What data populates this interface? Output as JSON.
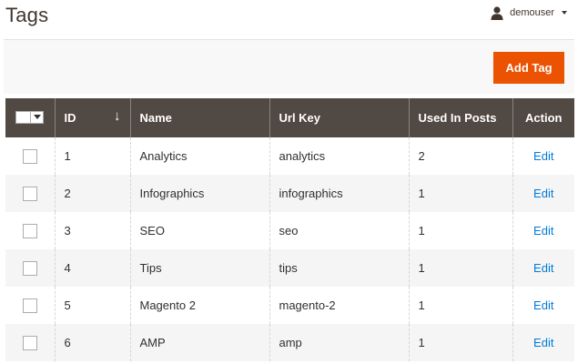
{
  "header": {
    "title": "Tags",
    "user": {
      "name": "demouser",
      "icon": "user-icon",
      "menu_icon": "chevron-down-icon"
    }
  },
  "actions": {
    "add_label": "Add Tag",
    "accent": "#eb5202"
  },
  "grid": {
    "header_bg": "#514943",
    "columns": {
      "id": "ID",
      "name": "Name",
      "url_key": "Url Key",
      "used_in_posts": "Used In Posts",
      "action": "Action"
    },
    "sort": {
      "column": "ID",
      "direction": "desc",
      "icon": "↓"
    },
    "rows": [
      {
        "id": "1",
        "name": "Analytics",
        "url_key": "analytics",
        "used": "2",
        "action": "Edit"
      },
      {
        "id": "2",
        "name": "Infographics",
        "url_key": "infographics",
        "used": "1",
        "action": "Edit"
      },
      {
        "id": "3",
        "name": "SEO",
        "url_key": "seo",
        "used": "1",
        "action": "Edit"
      },
      {
        "id": "4",
        "name": "Tips",
        "url_key": "tips",
        "used": "1",
        "action": "Edit"
      },
      {
        "id": "5",
        "name": "Magento 2",
        "url_key": "magento-2",
        "used": "1",
        "action": "Edit"
      },
      {
        "id": "6",
        "name": "AMP",
        "url_key": "amp",
        "used": "1",
        "action": "Edit"
      }
    ]
  }
}
